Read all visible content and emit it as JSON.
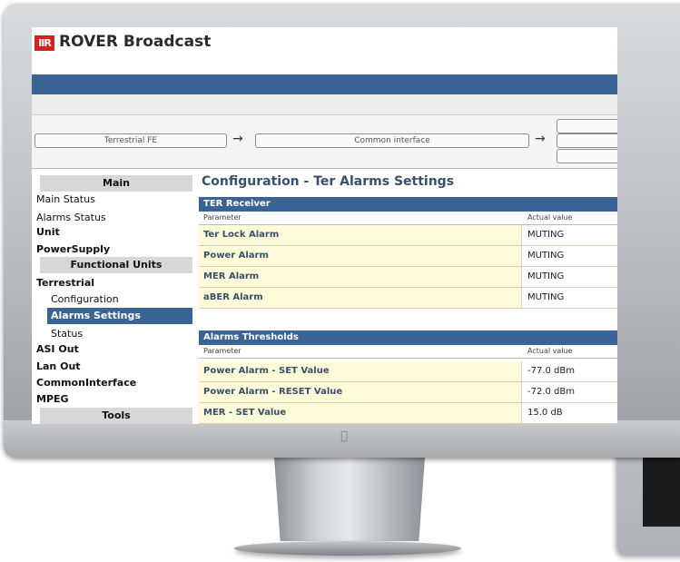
{
  "header": {
    "logo_mark": "IIR",
    "brand": "ROVER Broadcast"
  },
  "signal_chain": {
    "block1": "Terrestrial FE",
    "block2": "Common interface",
    "arrow": "→"
  },
  "sidebar": {
    "sections": [
      {
        "title": "Main"
      },
      {
        "title": "Functional Units"
      },
      {
        "title": "Tools"
      }
    ],
    "items": [
      {
        "label": "Main Status"
      },
      {
        "label": "Alarms Status"
      },
      {
        "label": "Unit"
      },
      {
        "label": "PowerSupply"
      },
      {
        "label": "Terrestrial"
      },
      {
        "label": "Configuration"
      },
      {
        "label": "Alarms Settings"
      },
      {
        "label": "Status"
      },
      {
        "label": "ASI Out"
      },
      {
        "label": "Lan Out"
      },
      {
        "label": "CommonInterface"
      },
      {
        "label": "MPEG"
      }
    ],
    "selected": "Alarms Settings"
  },
  "main": {
    "title": "Configuration - Ter Alarms Settings",
    "tables": [
      {
        "title": "TER Receiver",
        "col_param": "Parameter",
        "col_value": "Actual value",
        "rows": [
          {
            "param": "Ter Lock Alarm",
            "value": "MUTING"
          },
          {
            "param": "Power Alarm",
            "value": "MUTING"
          },
          {
            "param": "MER Alarm",
            "value": "MUTING"
          },
          {
            "param": "aBER Alarm",
            "value": "MUTING"
          }
        ]
      },
      {
        "title": "Alarms Thresholds",
        "col_param": "Parameter",
        "col_value": "Actual value",
        "rows": [
          {
            "param": "Power Alarm - SET Value",
            "value": "-77.0 dBm"
          },
          {
            "param": "Power Alarm - RESET Value",
            "value": "-72.0 dBm"
          },
          {
            "param": "MER - SET Value",
            "value": "15.0 dB"
          }
        ]
      }
    ]
  },
  "colors": {
    "accent": "#3a6496",
    "row_highlight": "#fdfbd8",
    "logo_red": "#d6221f"
  },
  "icons": {
    "apple": "apple-logo-icon"
  }
}
